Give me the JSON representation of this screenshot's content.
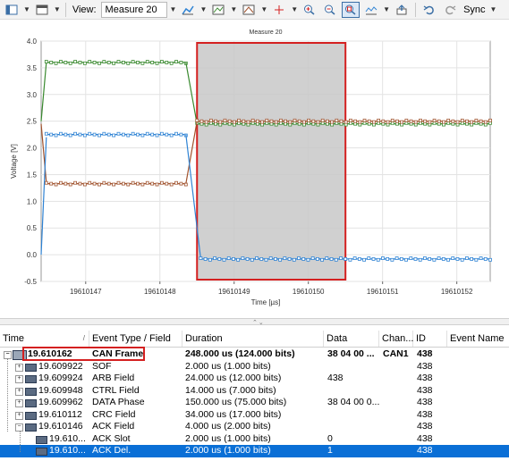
{
  "toolbar": {
    "view_label": "View:",
    "view_value": "Measure 20",
    "sync_label": "Sync"
  },
  "chart_data": {
    "type": "line",
    "title": "Measure 20",
    "xlabel": "Time [µs]",
    "ylabel": "Voltage [V]",
    "xlim": [
      19610146.4,
      19610152.45
    ],
    "ylim": [
      -0.5,
      4.0
    ],
    "yticks": [
      "4.0",
      "3.5",
      "3.0",
      "2.5",
      "2.0",
      "1.5",
      "1.0",
      "0.5",
      "0.0",
      "-0.5"
    ],
    "xticks": [
      "19610147",
      "19610148",
      "19610149",
      "19610150",
      "19610151",
      "19610152"
    ],
    "selection": [
      19610148.5,
      19610150.5
    ],
    "series": [
      {
        "color": "#3a8a2f",
        "segments": [
          {
            "x": [
              19610146.4,
              19610146.47
            ],
            "y": [
              2.5,
              3.6
            ]
          },
          {
            "x": [
              19610146.47,
              19610148.35
            ],
            "y": [
              3.6,
              3.6
            ]
          },
          {
            "x": [
              19610148.35,
              19610148.5
            ],
            "y": [
              3.6,
              2.45
            ]
          },
          {
            "x": [
              19610148.5,
              19610152.45
            ],
            "y": [
              2.45,
              2.45
            ]
          }
        ]
      },
      {
        "color": "#a0522d",
        "segments": [
          {
            "x": [
              19610146.4,
              19610146.47
            ],
            "y": [
              2.45,
              1.35
            ]
          },
          {
            "x": [
              19610146.47,
              19610148.35
            ],
            "y": [
              1.33,
              1.33
            ]
          },
          {
            "x": [
              19610148.35,
              19610148.5
            ],
            "y": [
              1.33,
              2.5
            ]
          },
          {
            "x": [
              19610148.5,
              19610152.45
            ],
            "y": [
              2.5,
              2.5
            ]
          }
        ]
      },
      {
        "color": "#2f83d4",
        "segments": [
          {
            "x": [
              19610146.4,
              19610146.47
            ],
            "y": [
              0.0,
              2.2
            ]
          },
          {
            "x": [
              19610146.47,
              19610148.35
            ],
            "y": [
              2.25,
              2.25
            ]
          },
          {
            "x": [
              19610148.35,
              19610148.55
            ],
            "y": [
              2.25,
              -0.08
            ]
          },
          {
            "x": [
              19610148.55,
              19610152.45
            ],
            "y": [
              -0.08,
              -0.08
            ]
          }
        ]
      }
    ]
  },
  "table": {
    "columns": [
      "Time",
      "Event Type / Field",
      "Duration",
      "Data",
      "Chan...",
      "ID",
      "Event Name"
    ],
    "rows": [
      {
        "time": "19.610162",
        "type": "CAN Frame",
        "duration": "248.000 us (124.000 bits)",
        "data": "38 04 00 ...",
        "chan": "CAN1",
        "id": "438",
        "bold": true,
        "level": 0
      },
      {
        "time": "19.609922",
        "type": "SOF",
        "duration": "2.000 us (1.000 bits)",
        "data": "",
        "chan": "",
        "id": "438",
        "level": 1
      },
      {
        "time": "19.609924",
        "type": "ARB Field",
        "duration": "24.000 us (12.000 bits)",
        "data": "438",
        "chan": "",
        "id": "438",
        "level": 1
      },
      {
        "time": "19.609948",
        "type": "CTRL Field",
        "duration": "14.000 us (7.000 bits)",
        "data": "",
        "chan": "",
        "id": "438",
        "level": 1
      },
      {
        "time": "19.609962",
        "type": "DATA Phase",
        "duration": "150.000 us (75.000 bits)",
        "data": "38 04 00 0...",
        "chan": "",
        "id": "438",
        "level": 1
      },
      {
        "time": "19.610112",
        "type": "CRC Field",
        "duration": "34.000 us (17.000 bits)",
        "data": "",
        "chan": "",
        "id": "438",
        "level": 1
      },
      {
        "time": "19.610146",
        "type": "ACK Field",
        "duration": "4.000 us (2.000 bits)",
        "data": "",
        "chan": "",
        "id": "438",
        "level": 1
      },
      {
        "time": "19.610...",
        "type": "ACK Slot",
        "duration": "2.000 us (1.000 bits)",
        "data": "0",
        "chan": "",
        "id": "438",
        "level": 2
      },
      {
        "time": "19.610...",
        "type": "ACK Del.",
        "duration": "2.000 us (1.000 bits)",
        "data": "1",
        "chan": "",
        "id": "438",
        "level": 2,
        "selected": true
      }
    ]
  }
}
